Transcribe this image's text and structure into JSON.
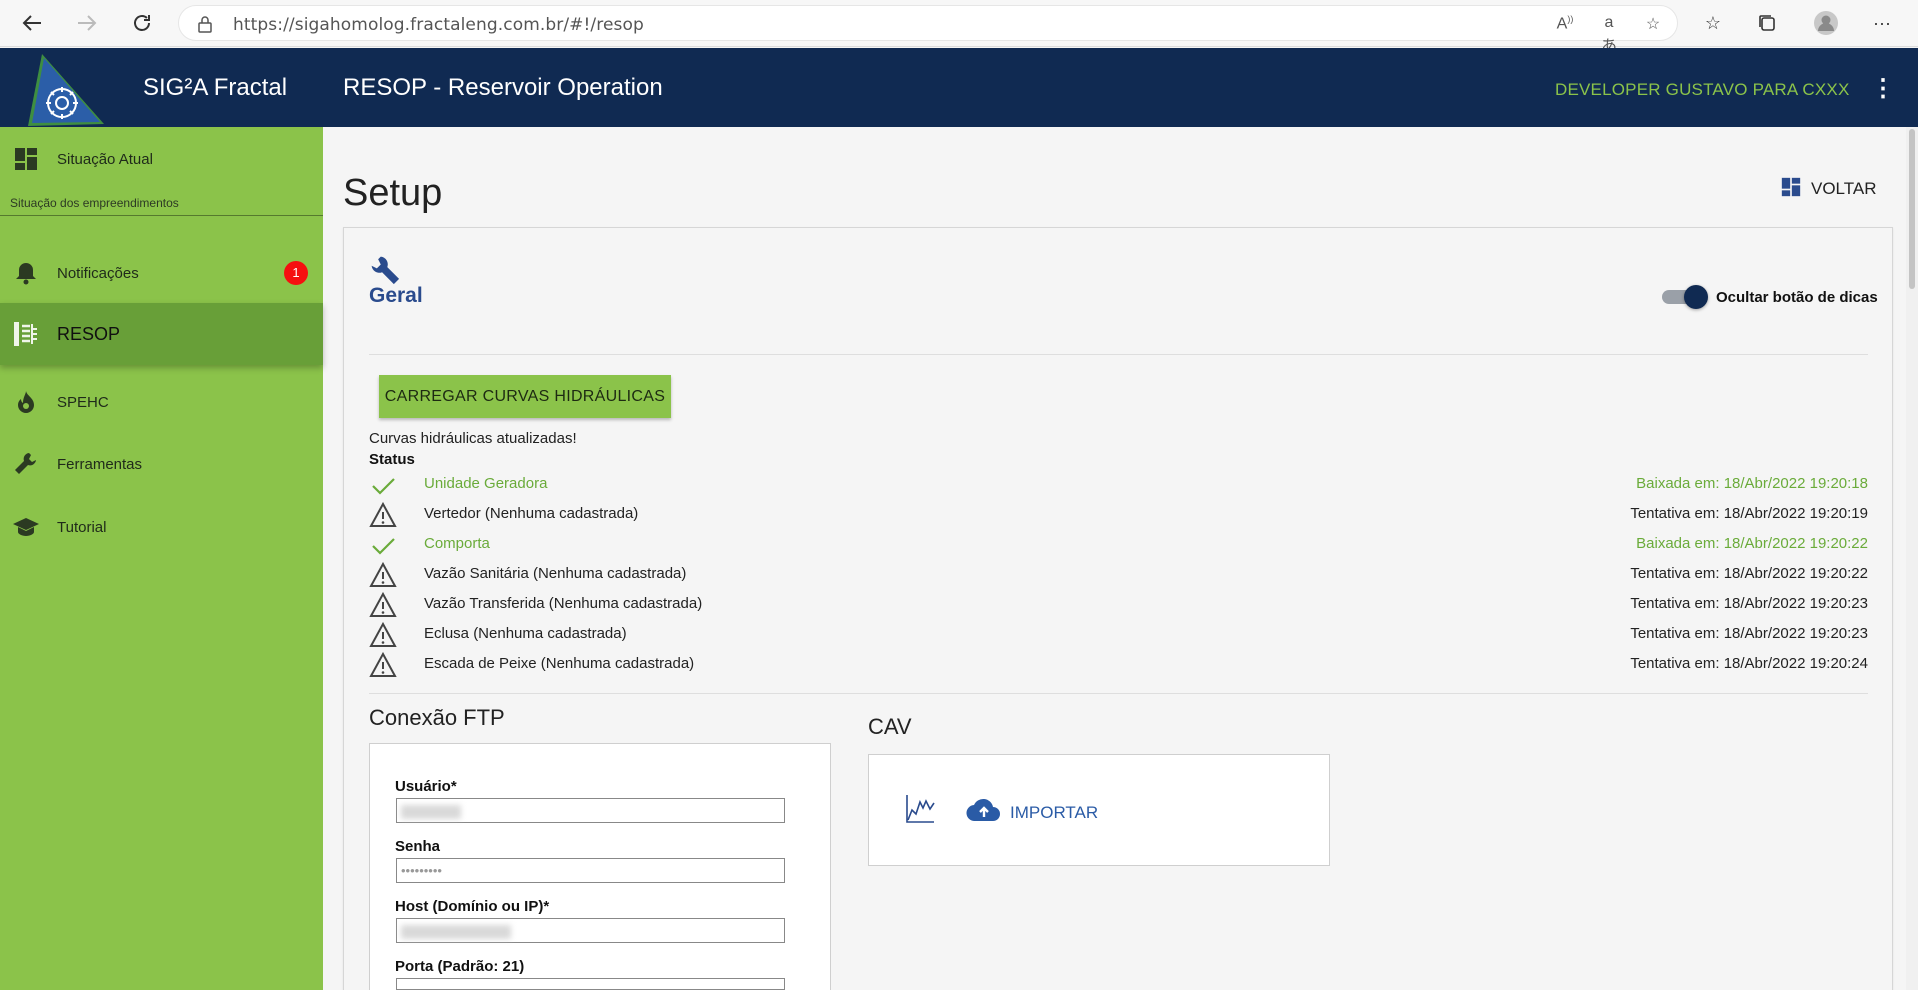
{
  "browser": {
    "url": "https://sigahomolog.fractaleng.com.br/#!/resop",
    "icons": [
      "back-icon",
      "forward-icon",
      "refresh-icon",
      "lock-icon",
      "read-aloud-icon",
      "translate-icon",
      "add-favorite-icon",
      "favorites-icon",
      "collections-icon",
      "profile-icon",
      "more-icon"
    ]
  },
  "header": {
    "app_name": "SIG²A Fractal",
    "module_title": "RESOP - Reservoir Operation",
    "user": "DEVELOPER GUSTAVO PARA CXXX",
    "colors": {
      "header_bg": "#102a52",
      "accent": "#8bc34a"
    }
  },
  "sidebar": {
    "items": [
      {
        "label": "Situação Atual",
        "icon": "dashboard-icon"
      },
      {
        "label": "Notificações",
        "icon": "bell-icon",
        "badge": "1"
      },
      {
        "label": "RESOP",
        "icon": "resop-icon",
        "active": true
      },
      {
        "label": "SPEHC",
        "icon": "fire-icon"
      },
      {
        "label": "Ferramentas",
        "icon": "wrench-icon"
      },
      {
        "label": "Tutorial",
        "icon": "graduation-cap-icon"
      }
    ],
    "subtitle": "Situação dos empreendimentos",
    "colors": {
      "bg": "#8bc34a",
      "active_bg": "#689f38"
    }
  },
  "main": {
    "title": "Setup",
    "back_label": "VOLTAR",
    "section": {
      "title": "Geral",
      "toggle_label": "Ocultar botão de dicas",
      "toggle_on": true,
      "load_button": "CARREGAR CURVAS HIDRÁULICAS",
      "message": "Curvas hidráulicas atualizadas!",
      "status_title": "Status",
      "status": [
        {
          "name": "Unidade Geradora",
          "time": "Baixada em: 18/Abr/2022 19:20:18",
          "state": "ok"
        },
        {
          "name": "Vertedor (Nenhuma cadastrada)",
          "time": "Tentativa em: 18/Abr/2022 19:20:19",
          "state": "warning"
        },
        {
          "name": "Comporta",
          "time": "Baixada em: 18/Abr/2022 19:20:22",
          "state": "ok"
        },
        {
          "name": "Vazão Sanitária (Nenhuma cadastrada)",
          "time": "Tentativa em: 18/Abr/2022 19:20:22",
          "state": "warning"
        },
        {
          "name": "Vazão Transferida (Nenhuma cadastrada)",
          "time": "Tentativa em: 18/Abr/2022 19:20:23",
          "state": "warning"
        },
        {
          "name": "Eclusa (Nenhuma cadastrada)",
          "time": "Tentativa em: 18/Abr/2022 19:20:23",
          "state": "warning"
        },
        {
          "name": "Escada de Peixe (Nenhuma cadastrada)",
          "time": "Tentativa em: 18/Abr/2022 19:20:24",
          "state": "warning"
        }
      ]
    },
    "ftp": {
      "title": "Conexão FTP",
      "fields": [
        {
          "label": "Usuário*",
          "value": ""
        },
        {
          "label": "Senha",
          "value": "•••••••••"
        },
        {
          "label": "Host (Domínio ou IP)*",
          "value": ""
        },
        {
          "label": "Porta (Padrão: 21)",
          "value": ""
        }
      ]
    },
    "cav": {
      "title": "CAV",
      "import_label": "IMPORTAR"
    }
  }
}
